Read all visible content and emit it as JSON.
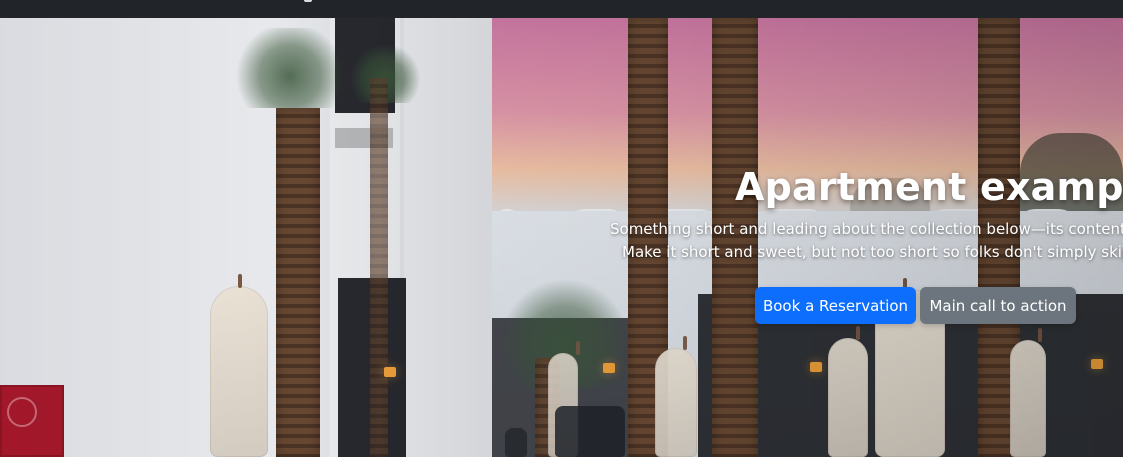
{
  "navbar": {
    "visible_text": ""
  },
  "hero": {
    "title": "Apartment example",
    "lead_lines": [
      "Something short and leading about the collection below—its contents, th",
      "Make it short and sweet, but not too short so folks don't simply skip ov"
    ],
    "buttons": {
      "primary_label": "Book a Reservation",
      "secondary_label": "Main call to action"
    }
  },
  "colors": {
    "navbar_bg": "#212529",
    "primary": "#0d6efd",
    "secondary": "#6c757d",
    "text": "#ffffff"
  }
}
